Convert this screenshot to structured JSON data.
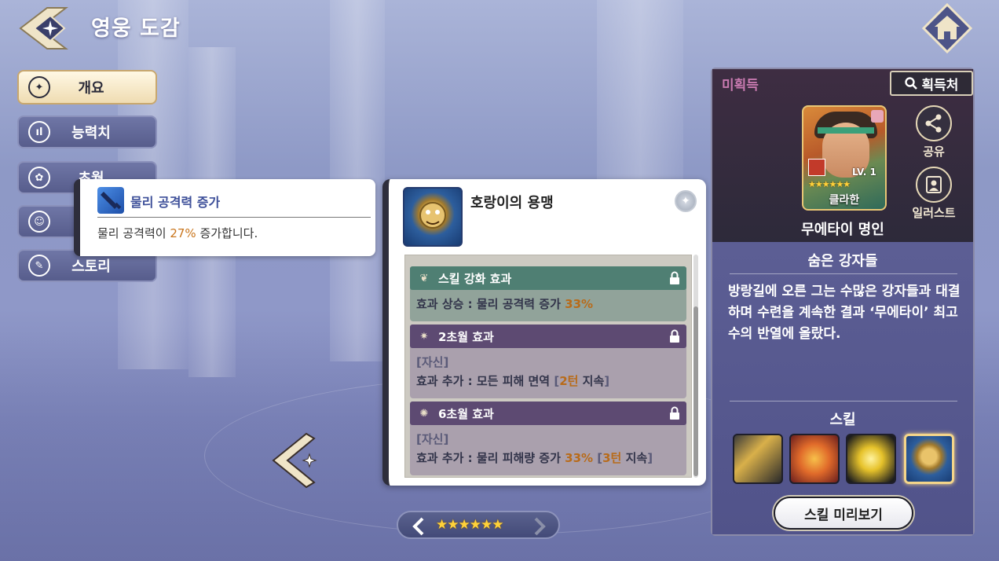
{
  "header": {
    "title": "영웅 도감"
  },
  "menu": {
    "items": [
      {
        "label": "개요",
        "icon": "compass-star-icon",
        "active": true
      },
      {
        "label": "능력치",
        "icon": "stats-bars-icon",
        "active": false
      },
      {
        "label": "초월",
        "icon": "transcend-flower-icon",
        "active": false
      },
      {
        "label": "",
        "icon": "profile-icon",
        "active": false
      },
      {
        "label": "스토리",
        "icon": "story-book-icon",
        "active": false
      }
    ]
  },
  "tooltip": {
    "title": "물리 공격력 증가",
    "desc_prefix": "물리 공격력이 ",
    "desc_value": "27%",
    "desc_suffix": " 증가합니다."
  },
  "skill_panel": {
    "name": "호랑이의 용맹",
    "effects": [
      {
        "title": "스킬 강화 효과",
        "line1_prefix": "효과 상승 : 물리 공격력 증가 ",
        "line1_value": "33%"
      },
      {
        "title": "2초월 효과",
        "target": "[자신]",
        "line_prefix": "효과 추가 : 모든 피해 면역 ",
        "bracket_open": "[",
        "turns": "2턴",
        "turns_suffix": " 지속",
        "bracket_close": "]"
      },
      {
        "title": "6초월 효과",
        "target": "[자신]",
        "line_prefix": "효과 추가 : 물리 피해량 증가 ",
        "value": "33%",
        "bracket_open": " [",
        "turns": "3턴",
        "turns_suffix": " 지속",
        "bracket_close": "]"
      }
    ]
  },
  "star_selector": {
    "stars": "★★★★★★",
    "star_count": 6
  },
  "hero": {
    "status": "미획득",
    "acquire_label": "획득처",
    "card_name": "클라한",
    "card_level": "LV. 1",
    "card_stars": "★★★★★★",
    "share_label": "공유",
    "illust_label": "일러스트",
    "title": "무에타이 명인",
    "story_title": "숨은 강자들",
    "story_text": "방랑길에 오른 그는 수많은 강자들과 대결하며 수련을 계속한 결과 ‘무에타이’ 최고수의 반열에 올랐다.",
    "skill_label": "스킬",
    "preview_label": "스킬 미리보기"
  },
  "colors": {
    "accent_gold": "#c9751c",
    "status_pink": "#c87ab0",
    "panel_dark": "#2f2a3a",
    "panel_blue": "#5c5e94"
  }
}
